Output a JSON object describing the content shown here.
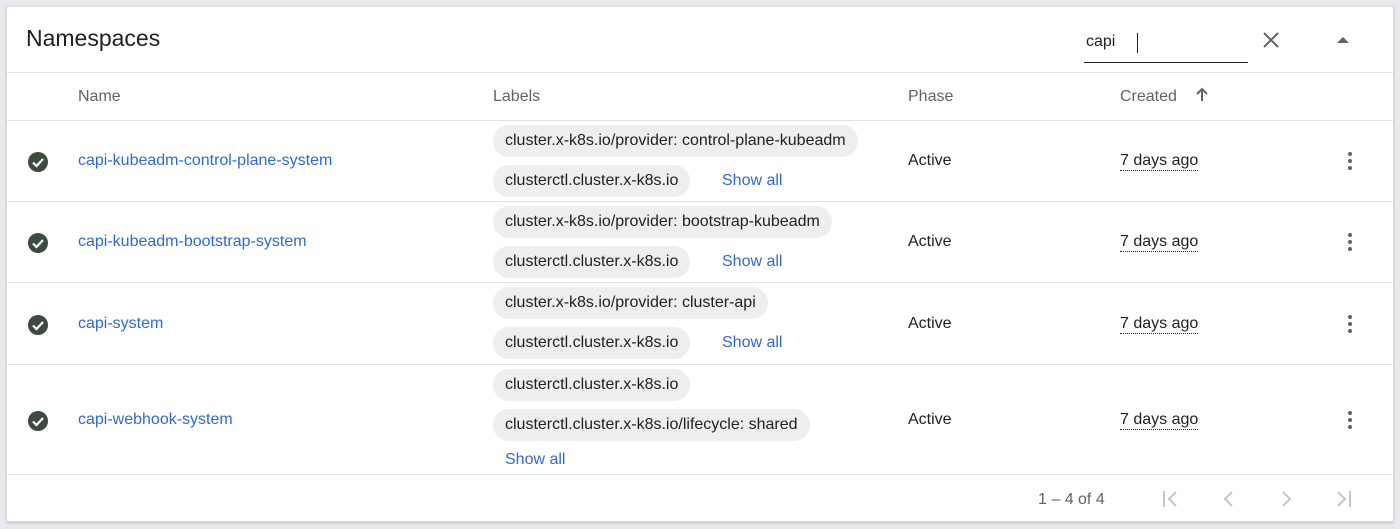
{
  "title": "Namespaces",
  "search": {
    "value": "capi"
  },
  "columns": {
    "name": "Name",
    "labels": "Labels",
    "phase": "Phase",
    "created": "Created"
  },
  "rows": [
    {
      "name": "capi-kubeadm-control-plane-system",
      "labels": [
        "cluster.x-k8s.io/provider: control-plane-kubeadm",
        "clusterctl.cluster.x-k8s.io"
      ],
      "show_all": "Show all",
      "phase": "Active",
      "created": "7 days ago",
      "status_icon": "check-circle-icon"
    },
    {
      "name": "capi-kubeadm-bootstrap-system",
      "labels": [
        "cluster.x-k8s.io/provider: bootstrap-kubeadm",
        "clusterctl.cluster.x-k8s.io"
      ],
      "show_all": "Show all",
      "phase": "Active",
      "created": "7 days ago",
      "status_icon": "check-circle-icon"
    },
    {
      "name": "capi-system",
      "labels": [
        "cluster.x-k8s.io/provider: cluster-api",
        "clusterctl.cluster.x-k8s.io"
      ],
      "show_all": "Show all",
      "phase": "Active",
      "created": "7 days ago",
      "status_icon": "check-circle-icon"
    },
    {
      "name": "capi-webhook-system",
      "labels": [
        "clusterctl.cluster.x-k8s.io",
        "clusterctl.cluster.x-k8s.io/lifecycle: shared"
      ],
      "show_all": "Show all",
      "phase": "Active",
      "created": "7 days ago",
      "status_icon": "check-circle-icon"
    }
  ],
  "pagination": {
    "range": "1 – 4 of 4"
  },
  "colors": {
    "link": "#3367d6",
    "status_ok": "#3d4a3e",
    "chip_bg": "#eeeeee"
  }
}
